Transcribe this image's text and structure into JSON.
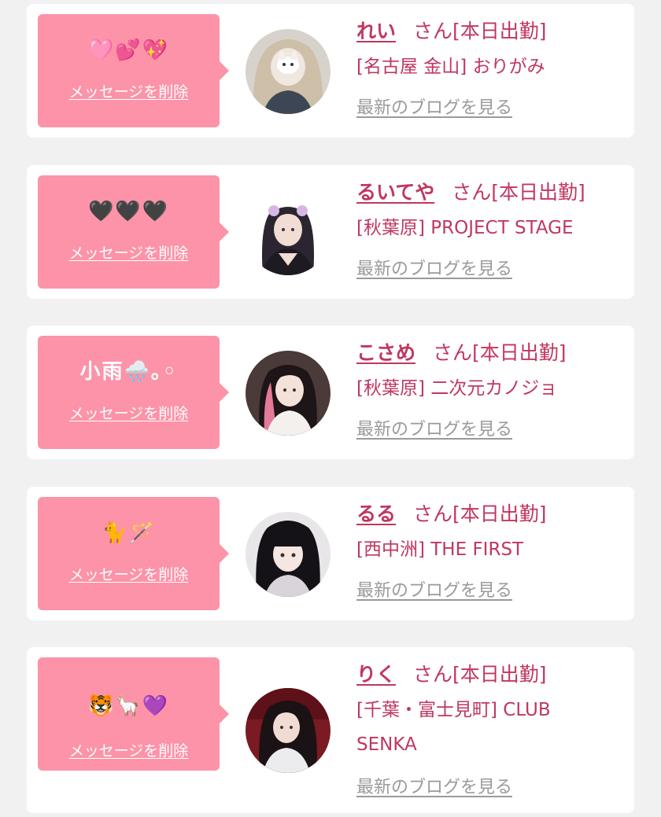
{
  "delete_label": "メッセージを削除",
  "blog_label": "最新のブログを見る",
  "honorific_status": "さん[本日出勤]",
  "colors": {
    "bubble": "#fc93a8",
    "accent": "#c0375f",
    "link_gray": "#9a9a9a",
    "background": "#f1f1f1"
  },
  "cards": [
    {
      "message": "🩷💕💖",
      "name": "れい",
      "shop": "[名古屋 金山] おりがみ"
    },
    {
      "message": "🖤🖤🖤",
      "name": "るいてや",
      "shop": "[秋葉原] PROJECT STAGE"
    },
    {
      "message": "小雨🌧️｡◦",
      "name": "こさめ",
      "shop": "[秋葉原] 二次元カノジョ"
    },
    {
      "message": "🐈🪄",
      "name": "るる",
      "shop": "[西中洲] THE FIRST"
    },
    {
      "message": "🐯🦙💜",
      "name": "りく",
      "shop": "[千葉・富士見町] CLUB SENKA"
    }
  ]
}
